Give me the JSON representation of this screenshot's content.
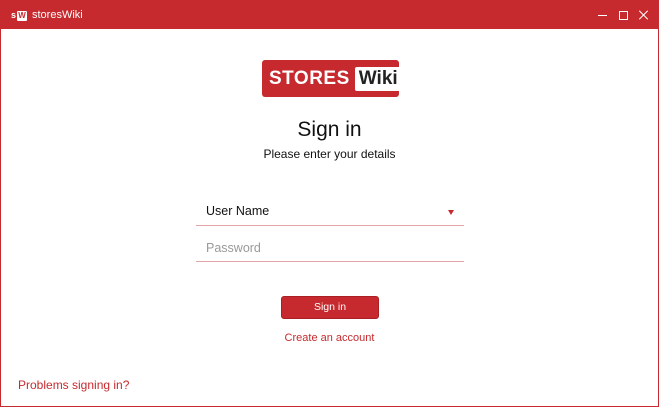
{
  "window": {
    "icon_letters": [
      "s",
      "W"
    ],
    "title": "storesWiki",
    "accent_color": "#c62a2e"
  },
  "logo": {
    "part1": "STORES",
    "part2": "Wiki"
  },
  "form": {
    "heading": "Sign in",
    "subheading": "Please enter your details",
    "username_value": "User Name",
    "password_placeholder": "Password",
    "signin_label": "Sign in",
    "create_account_label": "Create an account",
    "problems_label": "Problems signing in?"
  },
  "icons": {
    "minimize": "minimize-icon",
    "maximize": "maximize-icon",
    "close": "close-icon",
    "dropdown": "caret-down-icon"
  }
}
